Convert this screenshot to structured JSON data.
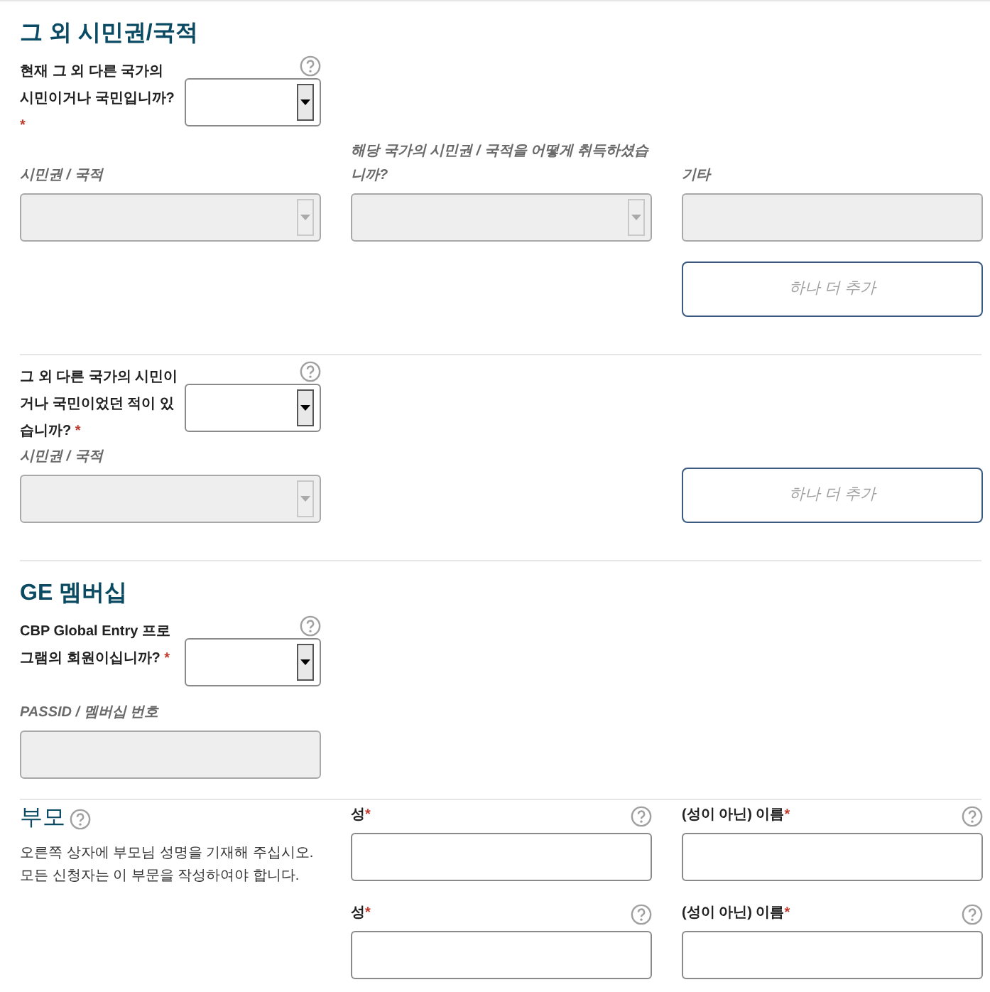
{
  "sections": [
    {
      "title": "그 외 시민권/국적",
      "question": {
        "label": "현재 그 외 다른 국가의 시민이거나 국민입니까?",
        "asterisk": "*",
        "help": true
      },
      "fields": [
        {
          "label": "시민권 / 국적",
          "kind": "select",
          "disabled": true
        },
        {
          "label": "해당 국가의 시민권 / 국적을 어떻게 취득하셨습니까?",
          "kind": "select",
          "disabled": true
        },
        {
          "label": "기타",
          "kind": "text",
          "disabled": true
        }
      ],
      "add_button": {
        "label": "하나 더 추가"
      }
    },
    {
      "question": {
        "label": "그 외 다른 국가의 시민이거나 국민이었던 적이 있습니까?",
        "asterisk": "*",
        "help": true
      },
      "fields": [
        {
          "label": "시민권 / 국적",
          "kind": "select",
          "disabled": true
        }
      ],
      "add_button": {
        "label": "하나 더 추가"
      }
    },
    {
      "title": "GE 멤버십",
      "question": {
        "label": "CBP Global Entry 프로그램의 회원이십니까?",
        "asterisk": "*",
        "help": true
      },
      "fields": [
        {
          "label": "PASSID / 멤버십 번호",
          "kind": "text",
          "disabled": true
        }
      ]
    }
  ],
  "parents": {
    "title": "부모",
    "help": true,
    "description": "오른쪽 상자에 부모님 성명을 기재해 주십시오. 모든 신청자는 이 부문을 작성하여야 합니다.",
    "rows": [
      [
        {
          "label": "성",
          "asterisk": "*",
          "help": true,
          "kind": "text",
          "disabled": false
        },
        {
          "label": "(성이 아닌) 이름",
          "asterisk": "*",
          "help": true,
          "kind": "text",
          "disabled": false
        }
      ],
      [
        {
          "label": "성",
          "asterisk": "*",
          "help": true,
          "kind": "text",
          "disabled": false
        },
        {
          "label": "(성이 아닌) 이름",
          "asterisk": "*",
          "help": true,
          "kind": "text",
          "disabled": false
        }
      ]
    ]
  }
}
